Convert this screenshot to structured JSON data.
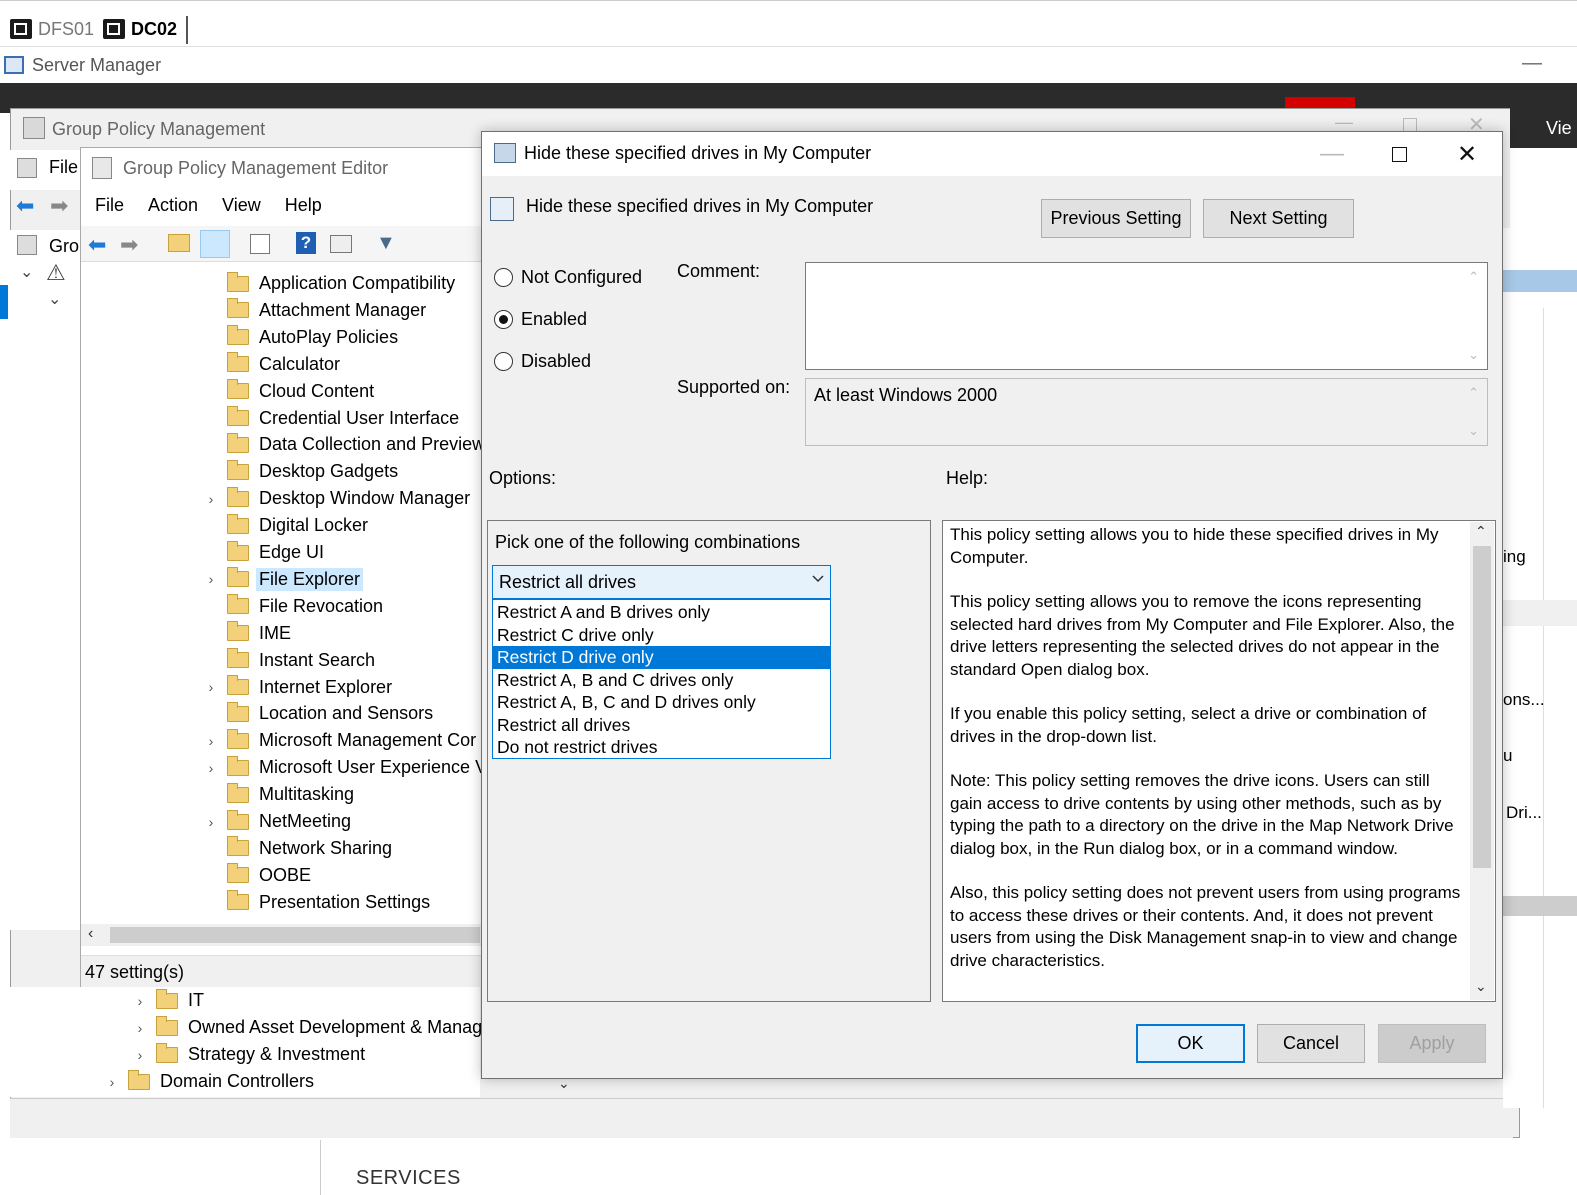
{
  "rdp_tabs": [
    {
      "label": "DFS01",
      "active": false
    },
    {
      "label": "DC02",
      "active": true
    }
  ],
  "server_manager": {
    "title": "Server Manager",
    "right_label": "Vie"
  },
  "gpm": {
    "title": "Group Policy Management",
    "menu_file": "File",
    "tree_root": "Gro"
  },
  "gpme": {
    "title": "Group Policy Management Editor",
    "menu": [
      "File",
      "Action",
      "View",
      "Help"
    ],
    "tree_items": [
      {
        "label": "Application Compatibility",
        "expandable": false
      },
      {
        "label": "Attachment Manager",
        "expandable": false
      },
      {
        "label": "AutoPlay Policies",
        "expandable": false
      },
      {
        "label": "Calculator",
        "expandable": false
      },
      {
        "label": "Cloud Content",
        "expandable": false
      },
      {
        "label": "Credential User Interface",
        "expandable": false
      },
      {
        "label": "Data Collection and Preview",
        "expandable": false
      },
      {
        "label": "Desktop Gadgets",
        "expandable": false
      },
      {
        "label": "Desktop Window Manager",
        "expandable": true
      },
      {
        "label": "Digital Locker",
        "expandable": false
      },
      {
        "label": "Edge UI",
        "expandable": false
      },
      {
        "label": "File Explorer",
        "expandable": true,
        "selected": true
      },
      {
        "label": "File Revocation",
        "expandable": false
      },
      {
        "label": "IME",
        "expandable": false
      },
      {
        "label": "Instant Search",
        "expandable": false
      },
      {
        "label": "Internet Explorer",
        "expandable": true
      },
      {
        "label": "Location and Sensors",
        "expandable": false
      },
      {
        "label": "Microsoft Management Cor",
        "expandable": true
      },
      {
        "label": "Microsoft User Experience V",
        "expandable": true
      },
      {
        "label": "Multitasking",
        "expandable": false
      },
      {
        "label": "NetMeeting",
        "expandable": true
      },
      {
        "label": "Network Sharing",
        "expandable": false
      },
      {
        "label": "OOBE",
        "expandable": false
      },
      {
        "label": "Presentation Settings",
        "expandable": false
      }
    ],
    "status": "47 setting(s)"
  },
  "gpm_lower_tree": [
    {
      "label": "IT",
      "indent": 1
    },
    {
      "label": "Owned Asset Development  & Manag",
      "indent": 1
    },
    {
      "label": "Strategy & Investment",
      "indent": 1
    },
    {
      "label": "Domain Controllers",
      "indent": 0
    }
  ],
  "dialog": {
    "title": "Hide these specified drives in My Computer",
    "setting_name": "Hide these specified drives in My Computer",
    "prev_button": "Previous Setting",
    "next_button": "Next Setting",
    "radios": [
      {
        "label": "Not Configured",
        "checked": false
      },
      {
        "label": "Enabled",
        "checked": true
      },
      {
        "label": "Disabled",
        "checked": false
      }
    ],
    "comment_label": "Comment:",
    "comment_value": "",
    "supported_label": "Supported on:",
    "supported_value": "At least Windows 2000",
    "options_label": "Options:",
    "help_label": "Help:",
    "options_prompt": "Pick one of the following combinations",
    "combo_selected": "Restrict all drives",
    "dropdown_options": [
      "Restrict A and B drives only",
      "Restrict C drive only",
      "Restrict D drive only",
      "Restrict A, B and C drives only",
      "Restrict A, B, C and D drives only",
      "Restrict all drives",
      "Do not restrict drives"
    ],
    "dropdown_highlight_index": 2,
    "help_paragraphs": [
      "This policy setting allows you to hide these specified drives in My Computer.",
      "This policy setting allows you to remove the icons representing selected hard drives from My Computer and File Explorer. Also, the drive letters representing the selected drives do not appear in the standard Open dialog box.",
      "If you enable this policy setting, select a drive or combination of drives in the drop-down list.",
      "Note: This policy setting removes the drive icons. Users can still gain access to drive contents by using other methods, such as by typing the path to a directory on the drive in the Map Network Drive dialog box, in the Run dialog box, or in a command window.",
      "Also, this policy setting does not prevent users from using programs to access these drives or their contents. And, it does not prevent users from using the Disk Management snap-in to view and change drive characteristics."
    ],
    "ok_button": "OK",
    "cancel_button": "Cancel",
    "apply_button": "Apply"
  },
  "right_partial": [
    "ing",
    "ons...",
    "u",
    "Dri..."
  ],
  "footer": {
    "services": "SERVICES"
  },
  "colors": {
    "accent": "#0078d7",
    "selection": "#cce8ff",
    "dialog_bg": "#f0f0f0"
  }
}
